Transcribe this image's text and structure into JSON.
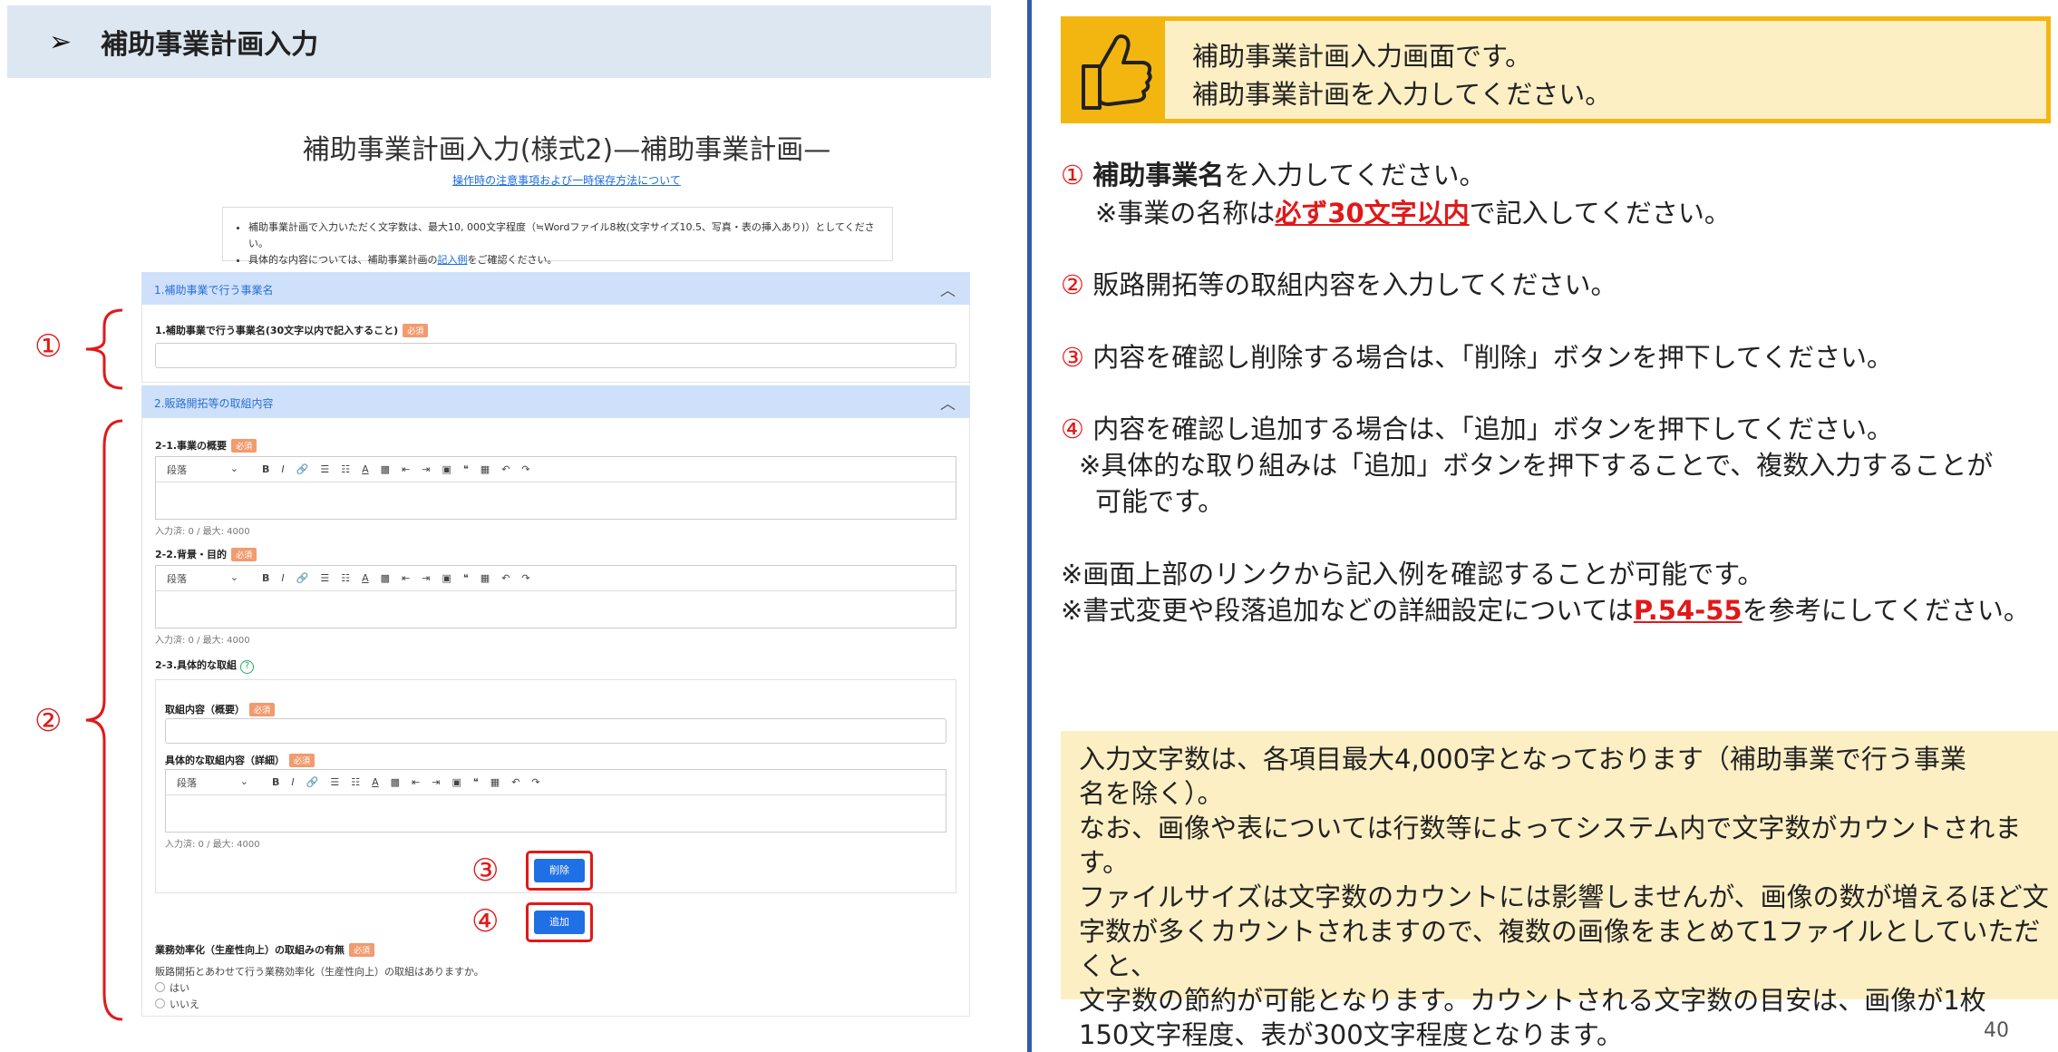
{
  "header": {
    "arrow": "➢",
    "title": "補助事業計画入力"
  },
  "form": {
    "title": "補助事業計画入力(様式2)—補助事業計画—",
    "link": "操作時の注意事項および一時保存方法について",
    "note1": "補助事業計画で入力いただく文字数は、最大10, 000文字程度（≒Wordファイル8枚(文字サイズ10.5、写真・表の挿入あり)）としてください。",
    "note2_a": "具体的な内容については、補助事業計画の",
    "note2_link": "記入例",
    "note2_b": "をご確認ください。",
    "required": "必須",
    "sec1_title": "1.補助事業で行う事業名",
    "sec1_field": "1.補助事業で行う事業名(30文字以内で記入すること)",
    "sec2_title": "2.販路開拓等の取組内容",
    "f21": "2-1.事業の概要",
    "f22": "2-2.背景・目的",
    "f23": "2-3.具体的な取組",
    "f23_help": "?",
    "sub_overview": "取組内容（概要）",
    "sub_detail": "具体的な取組内容（詳細）",
    "counter": "入力済: 0 / 最大: 4000",
    "delete_btn": "削除",
    "add_btn": "追加",
    "efficiency_label": "業務効率化（生産性向上）の取組みの有無",
    "efficiency_q": "販路開拓とあわせて行う業務効率化（生産性向上）の取組はありますか。",
    "yes": "はい",
    "no": "いいえ",
    "chevron": "︿"
  },
  "toolbar": {
    "para": "段落",
    "chev": "⌄",
    "bold": "B",
    "italic": "I",
    "link": "🔗",
    "ul": "☰",
    "ol": "☷",
    "color": "A",
    "bg": "▩",
    "outdent": "⇤",
    "indent": "⇥",
    "image": "▣",
    "quote": "❝",
    "table": "▦",
    "undo": "↶",
    "redo": "↷"
  },
  "markers": {
    "m1": "①",
    "m2": "②",
    "m3": "③",
    "m4": "④"
  },
  "callout": {
    "line1": "補助事業計画入力画面です。",
    "line2": "補助事業計画を入力してください。"
  },
  "instructions": {
    "i1_num": "①",
    "i1_bold": "補助事業名",
    "i1_rest": "を入力してください。",
    "i1_note_a": "※事業の名称は",
    "i1_note_red": "必ず30文字以内",
    "i1_note_b": "で記入してください。",
    "i2_num": "②",
    "i2": "販路開拓等の取組内容を入力してください。",
    "i3_num": "③",
    "i3": "内容を確認し削除する場合は、「削除」ボタンを押下してください。",
    "i4_num": "④",
    "i4": "内容を確認し追加する場合は、「追加」ボタンを押下してください。",
    "i4_note1": "※具体的な取り組みは「追加」ボタンを押下することで、複数入力することが",
    "i4_note2": "可能です。",
    "n1": "※画面上部のリンクから記入例を確認することが可能です。",
    "n2_a": "※書式変更や段落追加などの詳細設定については",
    "n2_red": "P.54-55",
    "n2_b": "を参考にしてください。"
  },
  "bottom": {
    "l1": "入力文字数は、各項目最大4,000字となっております（補助事業で行う事業",
    "l2": "名を除く）。",
    "l3": "なお、画像や表については行数等によってシステム内で文字数がカウントされます。",
    "l4": "ファイルサイズは文字数のカウントには影響しませんが、画像の数が増えるほど文",
    "l5": "字数が多くカウントされますので、複数の画像をまとめて1ファイルとしていただくと、",
    "l6": "文字数の節約が可能となります。カウントされる文字数の目安は、画像が1枚",
    "l7": "150文字程度、表が300文字程度となります。"
  },
  "page_number": "40"
}
